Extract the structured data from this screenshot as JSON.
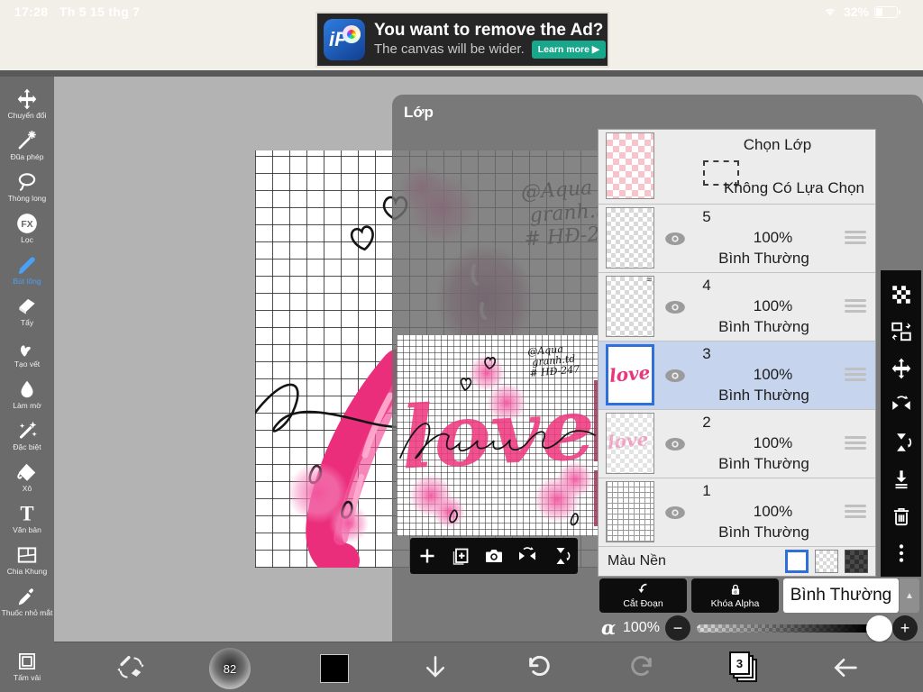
{
  "colors": {
    "accent_blue": "#4aa0f5",
    "selection_blue": "#2e6fd8",
    "pink": "#ee3a80",
    "teal_cta": "#19a78c"
  },
  "status_bar": {
    "time": "17:28",
    "date": "Th 5 15 thg 7",
    "battery": "32%"
  },
  "ad": {
    "logo": "iP",
    "title": "You want to remove the Ad?",
    "subtitle": "The canvas will be wider.",
    "cta": "Learn more ▶"
  },
  "sidebar": {
    "tools": [
      {
        "id": "transform",
        "icon": "move",
        "label": "Chuyển đổi",
        "active": false
      },
      {
        "id": "magic-wand",
        "icon": "wand",
        "label": "Đũa phép",
        "active": false
      },
      {
        "id": "lasso",
        "icon": "lasso",
        "label": "Thòng long",
        "active": false
      },
      {
        "id": "filter",
        "icon": "fx",
        "label": "Lọc",
        "active": false
      },
      {
        "id": "brush",
        "icon": "brush",
        "label": "Bút lông",
        "active": true
      },
      {
        "id": "eraser",
        "icon": "eraser",
        "label": "Tẩy",
        "active": false
      },
      {
        "id": "smudge",
        "icon": "smudge",
        "label": "Tạo vết",
        "active": false
      },
      {
        "id": "blur",
        "icon": "blur",
        "label": "Làm mờ",
        "active": false
      },
      {
        "id": "special",
        "icon": "special",
        "label": "Đặc biệt",
        "active": false
      },
      {
        "id": "bucket",
        "icon": "bucket",
        "label": "Xô",
        "active": false
      },
      {
        "id": "text",
        "icon": "text",
        "label": "Văn bản",
        "active": false
      },
      {
        "id": "divide-frame",
        "icon": "frame",
        "label": "Chia Khung",
        "active": false
      },
      {
        "id": "eyedropper",
        "icon": "dropper",
        "label": "Thuốc nhỏ mắt",
        "active": false
      }
    ],
    "canvas_tool": {
      "id": "canvas",
      "icon": "canvas",
      "label": "Tấm vải",
      "active": false
    }
  },
  "layers_panel": {
    "title": "Lớp",
    "select_row": {
      "title": "Chọn Lớp",
      "subtitle": "Không Có Lựa Chọn"
    },
    "layers": [
      {
        "num": "5",
        "opacity": "100%",
        "blend": "Bình Thường",
        "thumb": "empty",
        "selected": false
      },
      {
        "num": "4",
        "opacity": "100%",
        "blend": "Bình Thường",
        "thumb": "scribble",
        "selected": false
      },
      {
        "num": "3",
        "opacity": "100%",
        "blend": "Bình Thường",
        "thumb": "love",
        "selected": true
      },
      {
        "num": "2",
        "opacity": "100%",
        "blend": "Bình Thường",
        "thumb": "love-faint",
        "selected": false
      },
      {
        "num": "1",
        "opacity": "100%",
        "blend": "Bình Thường",
        "thumb": "grid",
        "selected": false
      }
    ],
    "background_row": {
      "label": "Màu Nền"
    },
    "clip_button": "Cắt Đoạn",
    "alpha_lock_button": "Khóa Alpha",
    "blend_select": "Bình Thường",
    "alpha": {
      "symbol": "α",
      "value": "100%"
    }
  },
  "artwork": {
    "word": "love",
    "signature_lines": [
      "@Aqua",
      "granh.td",
      "# HĐ-247"
    ]
  },
  "bottom_bar": {
    "brush_size": "82",
    "page_count": "3"
  }
}
